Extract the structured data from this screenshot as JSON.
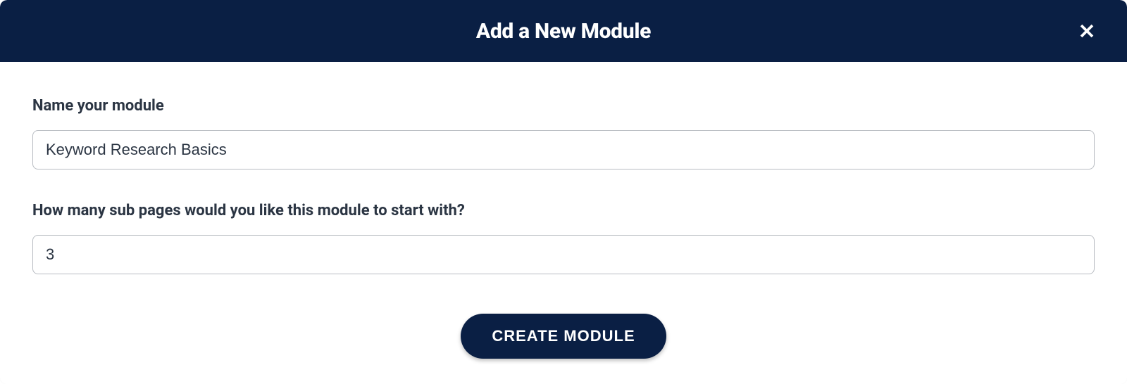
{
  "modal": {
    "title": "Add a New Module",
    "form": {
      "name_label": "Name your module",
      "name_value": "Keyword Research Basics",
      "subpages_label": "How many sub pages would you like this module to start with?",
      "subpages_value": "3"
    },
    "create_button": "CREATE MODULE"
  }
}
